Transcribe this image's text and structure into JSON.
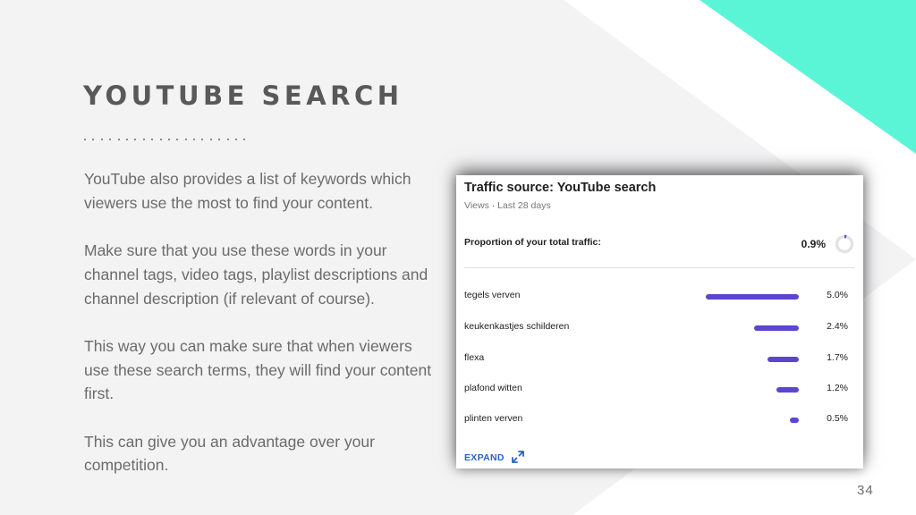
{
  "slide": {
    "title": "YOUTUBE SEARCH",
    "paragraphs": [
      "YouTube also provides a list of keywords which viewers use the most to find your content.",
      "Make sure that you use these words in your channel tags, video tags, playlist descriptions and channel description (if relevant of course).",
      "This way you can make sure that when viewers use these search terms, they will find your content first.",
      "This can give you an advantage over your competition."
    ],
    "page_number": "34",
    "accent_color": "#5af5d6"
  },
  "card": {
    "title": "Traffic source: YouTube search",
    "subtitle": "Views · Last 28 days",
    "proportion_label": "Proportion of your total traffic:",
    "proportion_value": "0.9%",
    "proportion_fraction": 0.009,
    "bar_color": "#5c46cf",
    "rows": [
      {
        "keyword": "tegels verven",
        "percent": "5.0%",
        "value": 5.0
      },
      {
        "keyword": "keukenkastjes schilderen",
        "percent": "2.4%",
        "value": 2.4
      },
      {
        "keyword": "flexa",
        "percent": "1.7%",
        "value": 1.7
      },
      {
        "keyword": "plafond witten",
        "percent": "1.2%",
        "value": 1.2
      },
      {
        "keyword": "plinten verven",
        "percent": "0.5%",
        "value": 0.5
      }
    ],
    "expand_label": "EXPAND",
    "expand_icon": "expand-arrows-icon"
  }
}
